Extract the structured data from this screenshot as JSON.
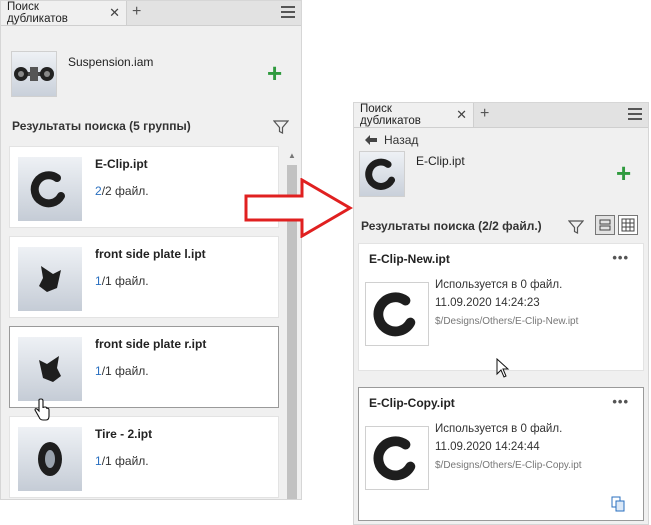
{
  "left": {
    "tab_label": "Поиск дубликатов",
    "tab_close": "✕",
    "tab_add": "+",
    "source_file": "Suspension.iam",
    "results_title": "Результаты поиска (5 группы)",
    "groups": [
      {
        "name": "E-Clip.ipt",
        "count_a": "2",
        "count_b": "/2 файл."
      },
      {
        "name": "front side plate l.ipt",
        "count_a": "1",
        "count_b": "/1 файл."
      },
      {
        "name": "front side plate r.ipt",
        "count_a": "1",
        "count_b": "/1 файл."
      },
      {
        "name": "Tire - 2.ipt",
        "count_a": "1",
        "count_b": "/1 файл."
      }
    ]
  },
  "right": {
    "tab_label": "Поиск дубликатов",
    "tab_close": "✕",
    "tab_add": "+",
    "back_label": "Назад",
    "source_file": "E-Clip.ipt",
    "results_title": "Результаты поиска (2/2 файл.)",
    "items": [
      {
        "name": "E-Clip-New.ipt",
        "used": "Используется в 0 файл.",
        "date": "11.09.2020 14:24:23",
        "path": "$/Designs/Others/E-Clip-New.ipt",
        "more": "•••"
      },
      {
        "name": "E-Clip-Copy.ipt",
        "used": "Используется в 0 файл.",
        "date": "11.09.2020 14:24:44",
        "path": "$/Designs/Others/E-Clip-Copy.ipt",
        "more": "•••"
      }
    ]
  },
  "icons": {
    "add": "+",
    "filter": "filter-icon",
    "menu": "hamburger-menu-icon",
    "back": "arrow-left-icon"
  },
  "colors": {
    "accent_green": "#2f9a3e",
    "count_blue": "#2a6fbf",
    "arrow_red": "#e02020"
  }
}
